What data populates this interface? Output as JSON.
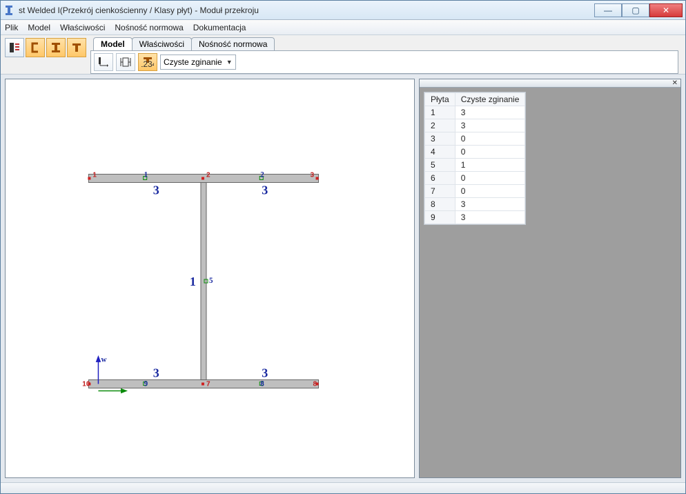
{
  "window": {
    "title": "st Welded I(Przekrój cienkościenny / Klasy płyt) - Moduł przekroju"
  },
  "menu": {
    "items": [
      "Plik",
      "Model",
      "Właściwości",
      "Nośność normowa",
      "Dokumentacja"
    ]
  },
  "toolbar_left": {
    "b1": "section-list-icon",
    "b2": "c-section-icon",
    "b3": "i-section-icon",
    "b4": "t-section-icon"
  },
  "tabs": {
    "items": [
      "Model",
      "Właściwości",
      "Nośność normowa"
    ],
    "active": 0
  },
  "panel": {
    "btn1": "local-axes-icon",
    "btn2": "dimensions-icon",
    "btn3": "numbering-icon",
    "btn3_label": "1234",
    "combo": "Czyste zginanie"
  },
  "canvas": {
    "big_labels": {
      "top_left": "3",
      "top_right": "3",
      "mid": "1",
      "bot_left": "3",
      "bot_right": "3"
    },
    "nodes_top": [
      "1",
      "1",
      "2",
      "2",
      "3"
    ],
    "nodes_bot": [
      "10",
      "9",
      "7",
      "8",
      "8"
    ],
    "node_mid": "5",
    "axis_w": "w"
  },
  "table": {
    "headers": [
      "Płyta",
      "Czyste zginanie"
    ],
    "rows": [
      {
        "id": "1",
        "val": "3"
      },
      {
        "id": "2",
        "val": "3"
      },
      {
        "id": "3",
        "val": "0"
      },
      {
        "id": "4",
        "val": "0"
      },
      {
        "id": "5",
        "val": "1"
      },
      {
        "id": "6",
        "val": "0"
      },
      {
        "id": "7",
        "val": "0"
      },
      {
        "id": "8",
        "val": "3"
      },
      {
        "id": "9",
        "val": "3"
      }
    ]
  }
}
